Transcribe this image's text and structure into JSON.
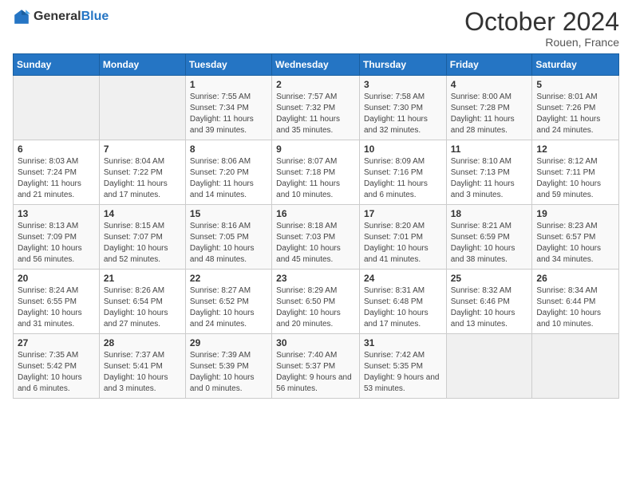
{
  "logo": {
    "general": "General",
    "blue": "Blue"
  },
  "header": {
    "month": "October 2024",
    "location": "Rouen, France"
  },
  "weekdays": [
    "Sunday",
    "Monday",
    "Tuesday",
    "Wednesday",
    "Thursday",
    "Friday",
    "Saturday"
  ],
  "weeks": [
    [
      {
        "day": "",
        "sunrise": "",
        "sunset": "",
        "daylight": ""
      },
      {
        "day": "",
        "sunrise": "",
        "sunset": "",
        "daylight": ""
      },
      {
        "day": "1",
        "sunrise": "Sunrise: 7:55 AM",
        "sunset": "Sunset: 7:34 PM",
        "daylight": "Daylight: 11 hours and 39 minutes."
      },
      {
        "day": "2",
        "sunrise": "Sunrise: 7:57 AM",
        "sunset": "Sunset: 7:32 PM",
        "daylight": "Daylight: 11 hours and 35 minutes."
      },
      {
        "day": "3",
        "sunrise": "Sunrise: 7:58 AM",
        "sunset": "Sunset: 7:30 PM",
        "daylight": "Daylight: 11 hours and 32 minutes."
      },
      {
        "day": "4",
        "sunrise": "Sunrise: 8:00 AM",
        "sunset": "Sunset: 7:28 PM",
        "daylight": "Daylight: 11 hours and 28 minutes."
      },
      {
        "day": "5",
        "sunrise": "Sunrise: 8:01 AM",
        "sunset": "Sunset: 7:26 PM",
        "daylight": "Daylight: 11 hours and 24 minutes."
      }
    ],
    [
      {
        "day": "6",
        "sunrise": "Sunrise: 8:03 AM",
        "sunset": "Sunset: 7:24 PM",
        "daylight": "Daylight: 11 hours and 21 minutes."
      },
      {
        "day": "7",
        "sunrise": "Sunrise: 8:04 AM",
        "sunset": "Sunset: 7:22 PM",
        "daylight": "Daylight: 11 hours and 17 minutes."
      },
      {
        "day": "8",
        "sunrise": "Sunrise: 8:06 AM",
        "sunset": "Sunset: 7:20 PM",
        "daylight": "Daylight: 11 hours and 14 minutes."
      },
      {
        "day": "9",
        "sunrise": "Sunrise: 8:07 AM",
        "sunset": "Sunset: 7:18 PM",
        "daylight": "Daylight: 11 hours and 10 minutes."
      },
      {
        "day": "10",
        "sunrise": "Sunrise: 8:09 AM",
        "sunset": "Sunset: 7:16 PM",
        "daylight": "Daylight: 11 hours and 6 minutes."
      },
      {
        "day": "11",
        "sunrise": "Sunrise: 8:10 AM",
        "sunset": "Sunset: 7:13 PM",
        "daylight": "Daylight: 11 hours and 3 minutes."
      },
      {
        "day": "12",
        "sunrise": "Sunrise: 8:12 AM",
        "sunset": "Sunset: 7:11 PM",
        "daylight": "Daylight: 10 hours and 59 minutes."
      }
    ],
    [
      {
        "day": "13",
        "sunrise": "Sunrise: 8:13 AM",
        "sunset": "Sunset: 7:09 PM",
        "daylight": "Daylight: 10 hours and 56 minutes."
      },
      {
        "day": "14",
        "sunrise": "Sunrise: 8:15 AM",
        "sunset": "Sunset: 7:07 PM",
        "daylight": "Daylight: 10 hours and 52 minutes."
      },
      {
        "day": "15",
        "sunrise": "Sunrise: 8:16 AM",
        "sunset": "Sunset: 7:05 PM",
        "daylight": "Daylight: 10 hours and 48 minutes."
      },
      {
        "day": "16",
        "sunrise": "Sunrise: 8:18 AM",
        "sunset": "Sunset: 7:03 PM",
        "daylight": "Daylight: 10 hours and 45 minutes."
      },
      {
        "day": "17",
        "sunrise": "Sunrise: 8:20 AM",
        "sunset": "Sunset: 7:01 PM",
        "daylight": "Daylight: 10 hours and 41 minutes."
      },
      {
        "day": "18",
        "sunrise": "Sunrise: 8:21 AM",
        "sunset": "Sunset: 6:59 PM",
        "daylight": "Daylight: 10 hours and 38 minutes."
      },
      {
        "day": "19",
        "sunrise": "Sunrise: 8:23 AM",
        "sunset": "Sunset: 6:57 PM",
        "daylight": "Daylight: 10 hours and 34 minutes."
      }
    ],
    [
      {
        "day": "20",
        "sunrise": "Sunrise: 8:24 AM",
        "sunset": "Sunset: 6:55 PM",
        "daylight": "Daylight: 10 hours and 31 minutes."
      },
      {
        "day": "21",
        "sunrise": "Sunrise: 8:26 AM",
        "sunset": "Sunset: 6:54 PM",
        "daylight": "Daylight: 10 hours and 27 minutes."
      },
      {
        "day": "22",
        "sunrise": "Sunrise: 8:27 AM",
        "sunset": "Sunset: 6:52 PM",
        "daylight": "Daylight: 10 hours and 24 minutes."
      },
      {
        "day": "23",
        "sunrise": "Sunrise: 8:29 AM",
        "sunset": "Sunset: 6:50 PM",
        "daylight": "Daylight: 10 hours and 20 minutes."
      },
      {
        "day": "24",
        "sunrise": "Sunrise: 8:31 AM",
        "sunset": "Sunset: 6:48 PM",
        "daylight": "Daylight: 10 hours and 17 minutes."
      },
      {
        "day": "25",
        "sunrise": "Sunrise: 8:32 AM",
        "sunset": "Sunset: 6:46 PM",
        "daylight": "Daylight: 10 hours and 13 minutes."
      },
      {
        "day": "26",
        "sunrise": "Sunrise: 8:34 AM",
        "sunset": "Sunset: 6:44 PM",
        "daylight": "Daylight: 10 hours and 10 minutes."
      }
    ],
    [
      {
        "day": "27",
        "sunrise": "Sunrise: 7:35 AM",
        "sunset": "Sunset: 5:42 PM",
        "daylight": "Daylight: 10 hours and 6 minutes."
      },
      {
        "day": "28",
        "sunrise": "Sunrise: 7:37 AM",
        "sunset": "Sunset: 5:41 PM",
        "daylight": "Daylight: 10 hours and 3 minutes."
      },
      {
        "day": "29",
        "sunrise": "Sunrise: 7:39 AM",
        "sunset": "Sunset: 5:39 PM",
        "daylight": "Daylight: 10 hours and 0 minutes."
      },
      {
        "day": "30",
        "sunrise": "Sunrise: 7:40 AM",
        "sunset": "Sunset: 5:37 PM",
        "daylight": "Daylight: 9 hours and 56 minutes."
      },
      {
        "day": "31",
        "sunrise": "Sunrise: 7:42 AM",
        "sunset": "Sunset: 5:35 PM",
        "daylight": "Daylight: 9 hours and 53 minutes."
      },
      {
        "day": "",
        "sunrise": "",
        "sunset": "",
        "daylight": ""
      },
      {
        "day": "",
        "sunrise": "",
        "sunset": "",
        "daylight": ""
      }
    ]
  ]
}
